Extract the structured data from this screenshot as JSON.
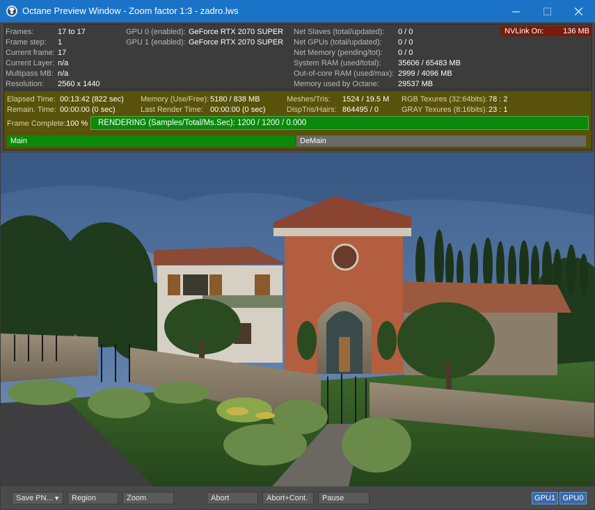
{
  "window": {
    "title": "Octane Preview Window - Zoom factor 1:3 - zadro.lws",
    "min_glyph": "—",
    "max_glyph": "☐",
    "close_glyph": "✕"
  },
  "stats": {
    "frames_label": "Frames:",
    "frames": "17 to 17",
    "frame_step_label": "Frame step:",
    "frame_step": "1",
    "current_frame_label": "Current frame:",
    "current_frame": "17",
    "current_layer_label": "Current Layer:",
    "current_layer": "n/a",
    "multipass_label": "Multipass MB:",
    "multipass": "n/a",
    "resolution_label": "Resolution:",
    "resolution": "2560 x 1440",
    "gpu0_label": "GPU  0 (enabled):",
    "gpu0": "GeForce RTX 2070 SUPER",
    "gpu1_label": "GPU  1 (enabled):",
    "gpu1": "GeForce RTX 2070 SUPER",
    "net_slaves_label": "Net Slaves (total/updated):",
    "net_slaves": "0 / 0",
    "net_gpus_label": "Net GPUs (total/updated):",
    "net_gpus": "0 / 0",
    "net_memory_label": "Net Memory (pending/tot):",
    "net_memory": "0 / 0",
    "system_ram_label": "System RAM (used/total):",
    "system_ram": "35606 / 65483 MB",
    "ooc_ram_label": "Out-of-core RAM (used/max):",
    "ooc_ram": "2999 / 4096 MB",
    "mem_octane_label": "Memory used by Octane:",
    "mem_octane": "29537 MB",
    "nvlink_label": "NVLink On:",
    "nvlink": "136 MB"
  },
  "render": {
    "elapsed_label": "Elapsed Time:",
    "elapsed": "00:13:42 (822 sec)",
    "remain_label": "Remain. Time:",
    "remain": "00:00:00 (0 sec)",
    "memory_label": "Memory (Use/Free):",
    "memory": "5180 / 838 MB",
    "last_render_label": "Last Render Time:",
    "last_render": "00:00:00 (0 sec)",
    "meshes_label": "Meshes/Tris:",
    "meshes": "1524 / 19.5 M",
    "disp_label": "DispTris/Hairs:",
    "disp": "864495 / 0",
    "rgb_label": "RGB Texures (32:64bits):",
    "rgb": "78 : 2",
    "gray_label": "GRAY Texures (8:16bits):",
    "gray": "23 : 1",
    "frame_complete_label": "Frame Complete:",
    "frame_complete": "100 %",
    "progress_text": "RENDERING (Samples/Total/Ms.Sec): 1200 / 1200 / 0.000",
    "progress_fraction": 1.0,
    "pass_main": "Main",
    "pass_demain": "DeMain"
  },
  "toolbar": {
    "save_label": "Save PN...",
    "save_caret": "▼",
    "region_label": "Region",
    "zoom_label": "Zoom",
    "abort_label": "Abort",
    "abort_cont_label": "Abort+Cont.",
    "pause_label": "Pause",
    "gpu1_label": "GPU1",
    "gpu0_label": "GPU0"
  },
  "colors": {
    "titlebar": "#1a73c7",
    "progress_green": "#0a8a0a",
    "stats_bg": "#58520a",
    "nvlink_bg": "#7a1a0a"
  }
}
